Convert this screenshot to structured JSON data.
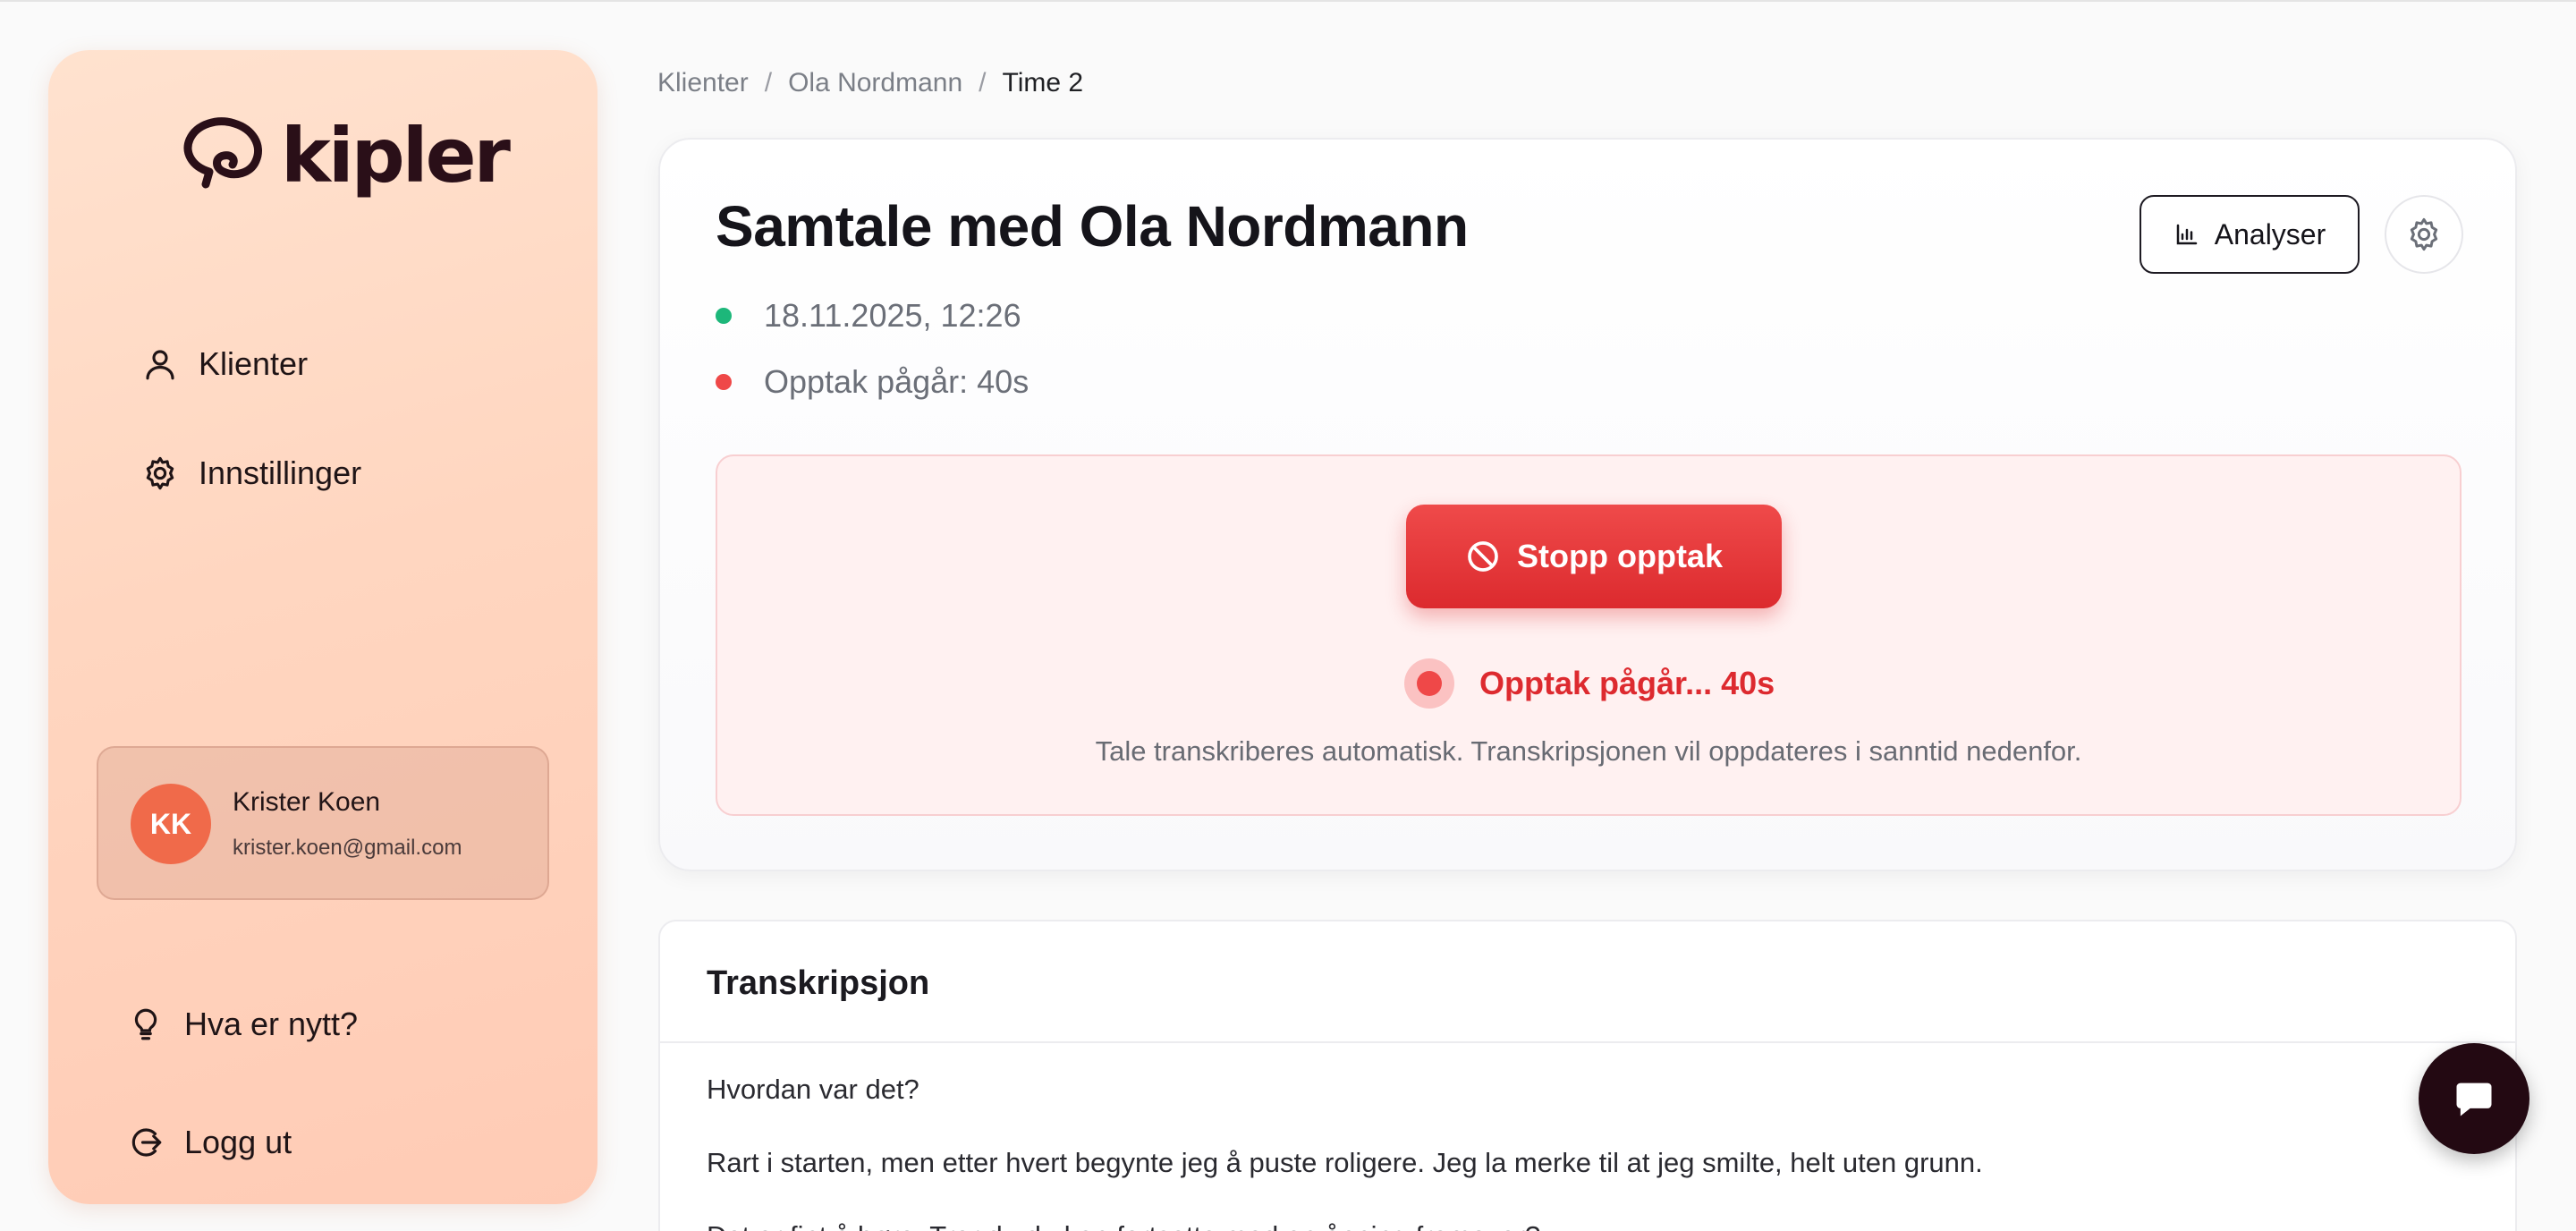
{
  "brand": {
    "name": "kipler"
  },
  "sidebar": {
    "items": [
      {
        "label": "Klienter",
        "icon": "user-icon"
      },
      {
        "label": "Innstillinger",
        "icon": "gear-icon"
      }
    ],
    "user": {
      "initials": "KK",
      "name": "Krister Koen",
      "email": "krister.koen@gmail.com"
    },
    "bottom": [
      {
        "label": "Hva er nytt?",
        "icon": "lightbulb-icon"
      },
      {
        "label": "Logg ut",
        "icon": "logout-icon"
      }
    ]
  },
  "breadcrumb": [
    "Klienter",
    "Ola Nordmann",
    "Time 2"
  ],
  "session": {
    "title": "Samtale med Ola Nordmann",
    "date": "18.11.2025, 12:26",
    "recording_status": "Opptak pågår: 40s",
    "analyse_label": "Analyser"
  },
  "recording": {
    "stop_label": "Stopp opptak",
    "status": "Opptak pågår... 40s",
    "hint": "Tale transkriberes automatisk. Transkripsjonen vil oppdateres i sanntid nedenfor."
  },
  "transcript": {
    "title": "Transkripsjon",
    "lines": [
      "Hvordan var det?",
      "Rart i starten, men etter hvert begynte jeg å puste roligere. Jeg la merke til at jeg smilte, helt uten grunn.",
      "Det er fint å høre. Tror du du kan fortsette med en åpning fremover?"
    ]
  },
  "colors": {
    "accent_red": "#dc2a2e",
    "status_green": "#1db77a",
    "sidebar_peach": "#ffd6c0",
    "avatar": "#f06a4a",
    "brand_dark": "#230912"
  }
}
